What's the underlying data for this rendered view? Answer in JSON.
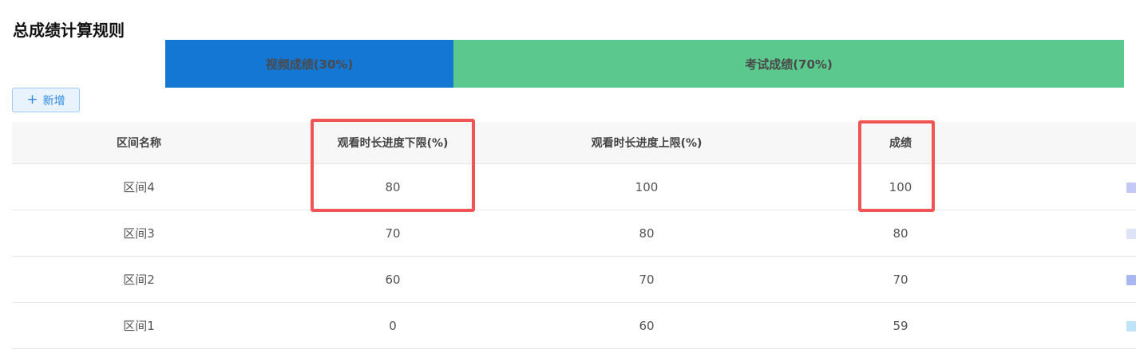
{
  "page": {
    "title": "总成绩计算规则"
  },
  "weights": {
    "video_label": "视频成绩(30%)",
    "exam_label": "考试成绩(70%)",
    "video_color": "#1477d4",
    "exam_color": "#5bc98e"
  },
  "toolbar": {
    "add_icon": "plus-icon",
    "add_label": "新增"
  },
  "table": {
    "headers": [
      "区间名称",
      "观看时长进度下限(%)",
      "观看时长进度上限(%)",
      "成绩"
    ],
    "rows": [
      {
        "name": "区间4",
        "lower": "80",
        "upper": "100",
        "score": "100",
        "mark_color": "#c4c8f5"
      },
      {
        "name": "区间3",
        "lower": "70",
        "upper": "80",
        "score": "80",
        "mark_color": "#dfe3f8"
      },
      {
        "name": "区间2",
        "lower": "60",
        "upper": "70",
        "score": "70",
        "mark_color": "#a9b6ef"
      },
      {
        "name": "区间1",
        "lower": "0",
        "upper": "60",
        "score": "59",
        "mark_color": "#bfe4f7"
      }
    ]
  },
  "annotations": {
    "highlight_color": "#f05454"
  }
}
